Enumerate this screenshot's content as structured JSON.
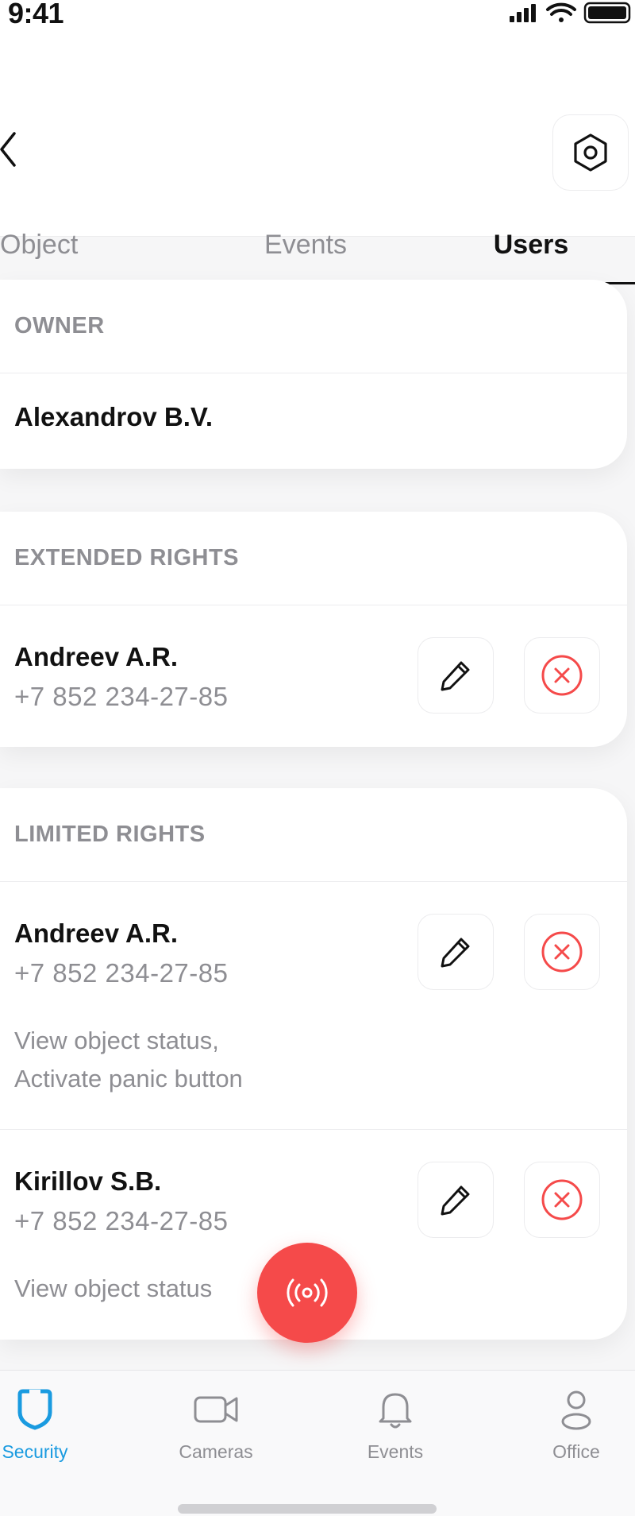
{
  "status_bar": {
    "time": "9:41"
  },
  "tabs": [
    {
      "label": "Object",
      "active": false
    },
    {
      "label": "Events",
      "active": false
    },
    {
      "label": "Users",
      "active": true
    }
  ],
  "sections": {
    "owner": {
      "title": "OWNER",
      "users": [
        {
          "name": "Alexandrov B.V."
        }
      ]
    },
    "extended": {
      "title": "EXTENDED RIGHTS",
      "users": [
        {
          "name": "Andreev A.R.",
          "phone": "+7 852 234-27-85"
        }
      ]
    },
    "limited": {
      "title": "LIMITED RIGHTS",
      "users": [
        {
          "name": "Andreev A.R.",
          "phone": "+7 852 234-27-85",
          "permissions_line1": "View object status,",
          "permissions_line2": "Activate panic button"
        },
        {
          "name": "Kirillov S.B.",
          "phone": "+7 852 234-27-85",
          "permissions_line1": "View object status"
        }
      ]
    }
  },
  "icons": {
    "back": "chevron-left-icon",
    "settings": "hexagon-gear-icon",
    "edit": "pencil-icon",
    "remove": "close-circle-icon",
    "panic": "broadcast-icon"
  },
  "tab_bar": [
    {
      "label": "Security",
      "icon": "shield-icon",
      "active": true
    },
    {
      "label": "Cameras",
      "icon": "video-camera-icon",
      "active": false
    },
    {
      "label": "Events",
      "icon": "bell-icon",
      "active": false
    },
    {
      "label": "Office",
      "icon": "person-icon",
      "active": false
    }
  ],
  "colors": {
    "accent_blue": "#1A9BE0",
    "danger_red": "#F54A4A",
    "text_primary": "#111111",
    "text_secondary": "#8E8E93",
    "background": "#F6F6F7"
  }
}
